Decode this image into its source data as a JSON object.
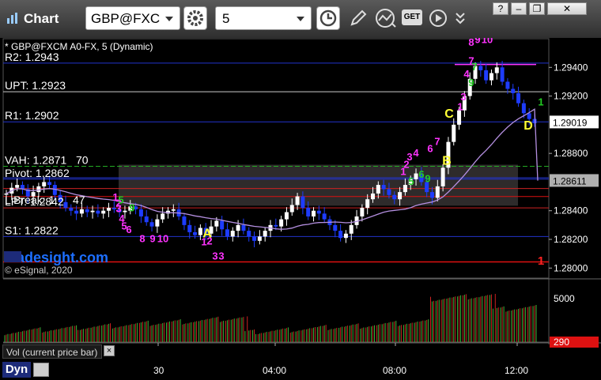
{
  "app": {
    "title": "Chart",
    "symbol": "GBP@FXC",
    "interval": "5"
  },
  "window_controls": {
    "help": "?",
    "minimize": "–",
    "restore": "❐",
    "close": "✕"
  },
  "toolbar_icons": [
    "settings-icon",
    "clock-icon",
    "pencil-icon",
    "line-tool-icon",
    "get-icon",
    "play-icon",
    "chevrons-icon"
  ],
  "get_label": "GET",
  "chart_data": [
    {
      "type": "candlestick",
      "header": "* GBP@FXCM A0-FX, 5 (Dynamic)",
      "watermark": "tradesight.com",
      "copyright": "© eSignal, 2020",
      "y_ticks": [
        "1.29400",
        "1.29200",
        "1.28800",
        "1.28400",
        "1.28200",
        "1.28000"
      ],
      "last_price": "1.29019",
      "ma_price": "1.28611",
      "ylim": [
        1.2793,
        1.296
      ],
      "levels": [
        {
          "label": "R2: 1.2943",
          "value": 1.2943,
          "color": "#2233cc"
        },
        {
          "label": "UPT: 1.2923",
          "value": 1.2923,
          "color": "#cccccc"
        },
        {
          "label": "R1: 1.2902",
          "value": 1.2902,
          "color": "#2233cc"
        },
        {
          "label": "VAH: 1.2871",
          "value": 1.2871,
          "color": "#22aa22"
        },
        {
          "label": "Pivot: 1.2862",
          "value": 1.2862,
          "color": "#2233cc"
        },
        {
          "label": "LPT: 1.2842",
          "value": 1.2842,
          "color": "#cc2222"
        },
        {
          "label": "S1: 1.2822",
          "value": 1.2822,
          "color": "#2233cc"
        }
      ],
      "extra_level_texts": [
        "70",
        "L Break: 1",
        "47"
      ],
      "annotations": [
        {
          "text": "A",
          "color": "#ffff33"
        },
        {
          "text": "B",
          "color": "#ffff33"
        },
        {
          "text": "C",
          "color": "#ffff33"
        },
        {
          "text": "D",
          "color": "#ffff33"
        }
      ],
      "td_counts": [
        "1",
        "2",
        "3",
        "4",
        "5",
        "6",
        "7",
        "8",
        "9",
        "10"
      ],
      "close_series": [
        1.2852,
        1.2856,
        1.2858,
        1.2855,
        1.285,
        1.2853,
        1.2857,
        1.286,
        1.2858,
        1.2851,
        1.2846,
        1.2842,
        1.284,
        1.2838,
        1.2841,
        1.2839,
        1.284,
        1.2838,
        1.284,
        1.2842,
        1.2841,
        1.2839,
        1.284,
        1.2843,
        1.2841,
        1.2836,
        1.2832,
        1.2829,
        1.2834,
        1.2838,
        1.284,
        1.2841,
        1.2836,
        1.283,
        1.2825,
        1.2823,
        1.2828,
        1.2824,
        1.2829,
        1.2833,
        1.2827,
        1.2822,
        1.2826,
        1.283,
        1.2826,
        1.2822,
        1.2819,
        1.2822,
        1.2826,
        1.283,
        1.2829,
        1.2834,
        1.2839,
        1.2844,
        1.285,
        1.2842,
        1.2836,
        1.284,
        1.2838,
        1.2834,
        1.283,
        1.2826,
        1.2821,
        1.2824,
        1.283,
        1.2836,
        1.2842,
        1.2848,
        1.2852,
        1.2858,
        1.2855,
        1.2851,
        1.2848,
        1.2853,
        1.2858,
        1.2862,
        1.2866,
        1.286,
        1.2853,
        1.2849,
        1.2857,
        1.287,
        1.2888,
        1.29,
        1.291,
        1.292,
        1.2932,
        1.2941,
        1.2938,
        1.2931,
        1.2936,
        1.294,
        1.293,
        1.2925,
        1.2922,
        1.2915,
        1.2908,
        1.2904,
        1.2901
      ],
      "volume_axis": [
        "5000",
        "290"
      ],
      "volume_label": "Vol (current price bar)",
      "x_ticks": [
        "30",
        "04:00",
        "08:00",
        "12:00"
      ],
      "dyn_label": "Dyn"
    }
  ]
}
